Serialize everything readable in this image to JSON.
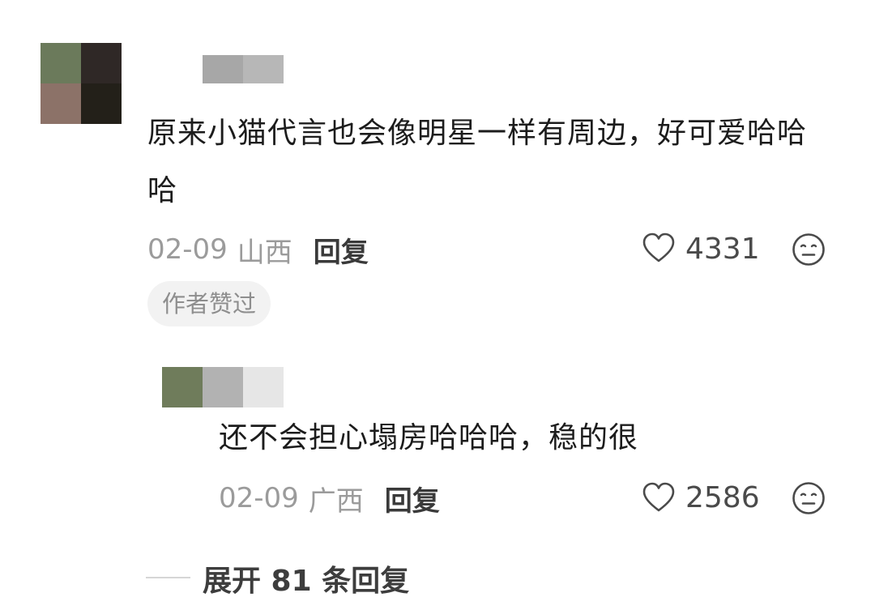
{
  "comments": [
    {
      "text": "原来小猫代言也会像明星一样有周边，好可爱哈哈哈",
      "date": "02-09",
      "location": "山西",
      "reply_label": "回复",
      "likes": "4331",
      "author_badge": "作者赞过"
    },
    {
      "text": "还不会担心塌房哈哈哈，稳的很",
      "date": "02-09",
      "location": "广西",
      "reply_label": "回复",
      "likes": "2586"
    }
  ],
  "expand_replies_label": "展开 81 条回复",
  "icons": {
    "like": "heart-outline-icon",
    "dislike": "neutral-face-icon"
  },
  "colors": {
    "text_primary": "#1c1c1c",
    "text_meta": "#9b9b9b",
    "badge_bg": "#f2f2f2"
  }
}
